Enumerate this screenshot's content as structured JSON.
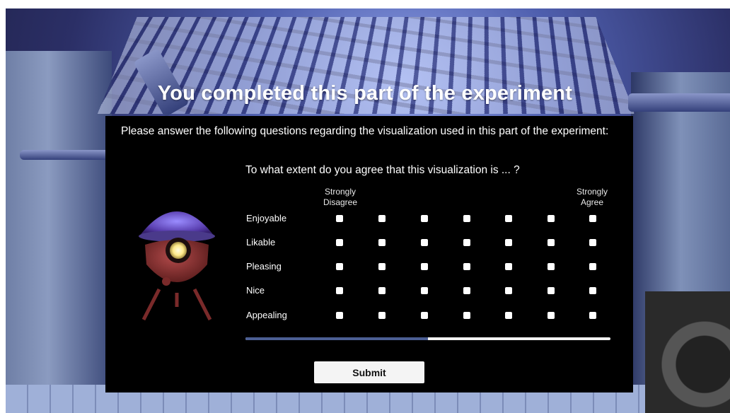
{
  "screen": {
    "title": "You completed this part of the experiment"
  },
  "panel": {
    "intro": "Please answer the following questions regarding the visualization used in this part of the experiment:",
    "question": "To what extent do you agree that this visualization is ... ?",
    "scale": {
      "left_anchor": "Strongly Disagree",
      "right_anchor": "Strongly Agree",
      "points": 7
    },
    "items": [
      {
        "label": "Enjoyable"
      },
      {
        "label": "Likable"
      },
      {
        "label": "Pleasing"
      },
      {
        "label": "Nice"
      },
      {
        "label": "Appealing"
      }
    ],
    "progress_fraction": 0.5,
    "submit_label": "Submit"
  },
  "colors": {
    "panel_bg": "#000000",
    "progress_fill": "#4c5f94",
    "progress_track": "#f2f2f2",
    "button_bg": "#f4f4f4"
  },
  "icons": {
    "illustration": "robot-lamp-icon"
  }
}
